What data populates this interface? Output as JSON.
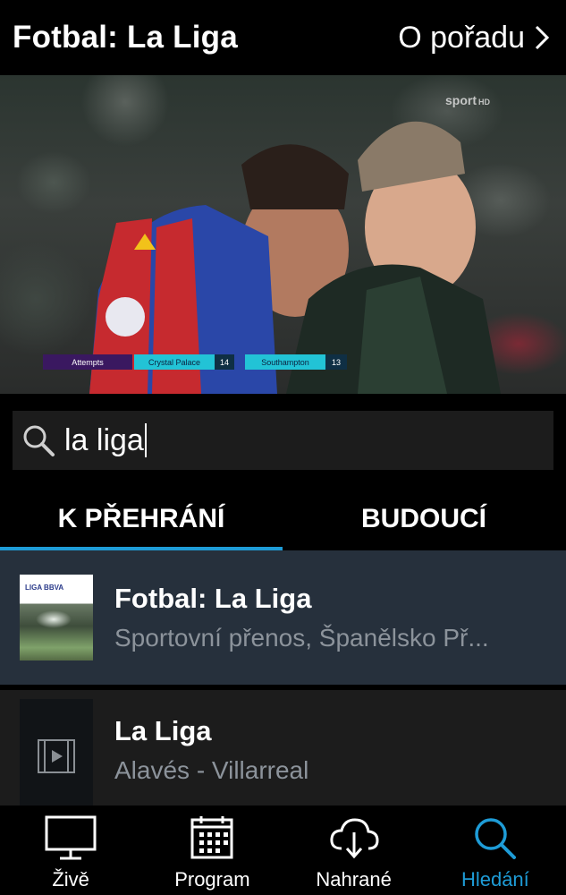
{
  "header": {
    "title": "Fotbal: La Liga",
    "about_label": "O pořadu"
  },
  "video": {
    "channel_logo": "sport",
    "channel_quality": "HD",
    "stats": {
      "label": "Attempts",
      "team1": "Crystal Palace",
      "team1_value": "14",
      "team2": "Southampton",
      "team2_value": "13"
    }
  },
  "search": {
    "value": "la liga",
    "icon": "search-icon"
  },
  "tabs": [
    {
      "label": "K PŘEHRÁNÍ",
      "active": true
    },
    {
      "label": "BUDOUCÍ",
      "active": false
    }
  ],
  "results": [
    {
      "title": "Fotbal: La Liga",
      "subtitle": "Sportovní přenos, Španělsko Př...",
      "thumb_brand": "LIGA BBVA"
    },
    {
      "title": "La Liga",
      "subtitle": "Alavés - Villarreal"
    }
  ],
  "nav": [
    {
      "label": "Živě",
      "icon": "tv-icon"
    },
    {
      "label": "Program",
      "icon": "calendar-icon"
    },
    {
      "label": "Nahrané",
      "icon": "cloud-download-icon"
    },
    {
      "label": "Hledání",
      "icon": "search-icon",
      "active": true
    }
  ],
  "colors": {
    "accent": "#1e9cd7",
    "selected_row": "#26303c"
  }
}
